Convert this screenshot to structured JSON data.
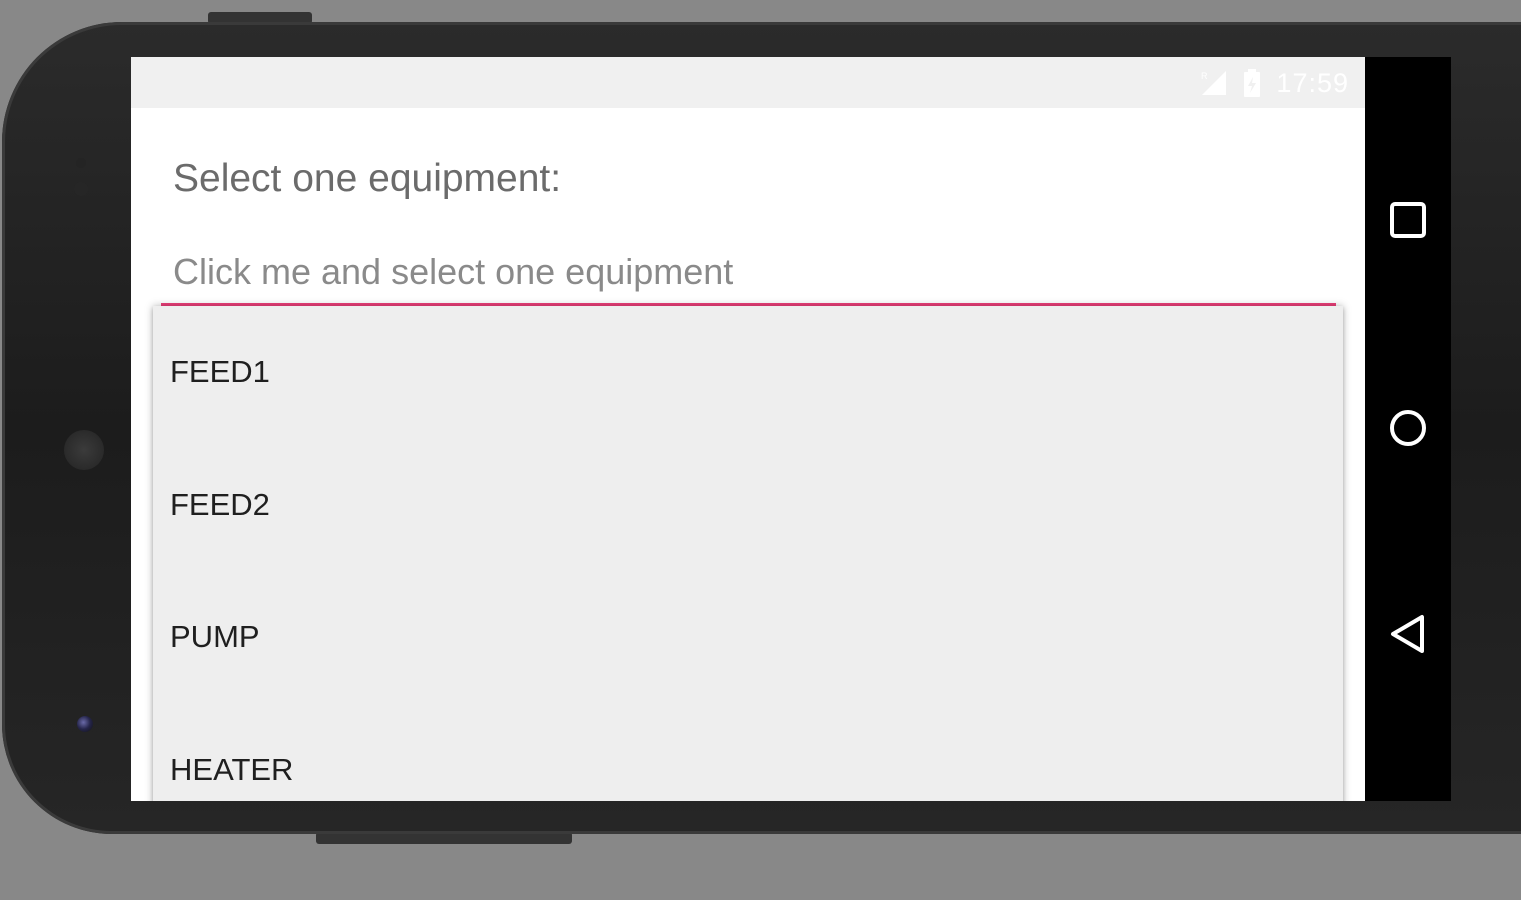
{
  "status_bar": {
    "time": "17:59",
    "icons": [
      "signal-icon",
      "battery-icon"
    ]
  },
  "form": {
    "prompt": "Select one equipment:",
    "spinner_placeholder": "Click me and select one equipment",
    "accent_color": "#ec407a"
  },
  "dropdown": {
    "items": [
      {
        "label": "FEED1"
      },
      {
        "label": "FEED2"
      },
      {
        "label": "PUMP"
      },
      {
        "label": "HEATER"
      }
    ]
  },
  "nav_bar": {
    "buttons": [
      "recents-icon",
      "home-icon",
      "back-icon"
    ]
  }
}
